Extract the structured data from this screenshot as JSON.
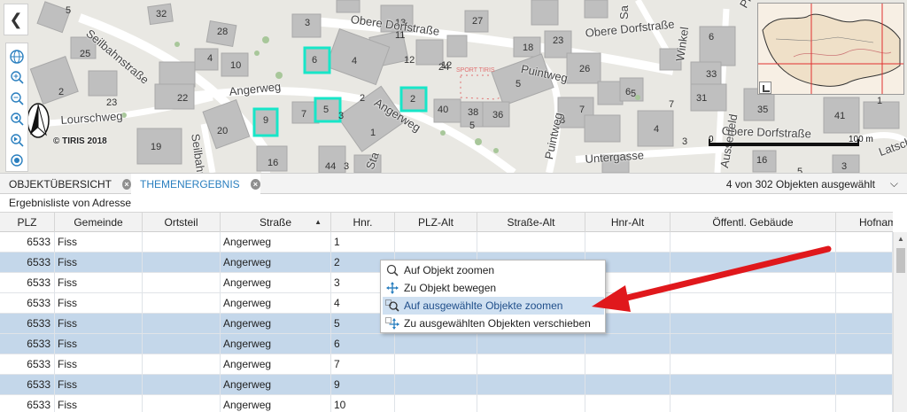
{
  "map": {
    "copyright": "© TIRIS 2018",
    "scale_left": "0",
    "scale_right": "100 m",
    "streets": [
      "Obere Dorfstraße",
      "Seilbahnstraße",
      "Angerweg",
      "Lourschweg",
      "Angerweg",
      "Puintweg",
      "Puintweg",
      "Obere Dorfstraße",
      "Obere Dorfstraße",
      "Untergasse",
      "Winkel",
      "Seilbahn",
      "Sa",
      "Latsch",
      "Pla",
      "Ausserfeld",
      "Sta"
    ],
    "house_numbers": [
      "32",
      "3",
      "13",
      "27",
      "5",
      "28",
      "11",
      "18",
      "23",
      "4",
      "25",
      "6",
      "4",
      "10",
      "12",
      "24",
      "26",
      "6",
      "33",
      "2",
      "23",
      "22",
      "2",
      "5",
      "6",
      "12",
      "31",
      "9",
      "7",
      "5",
      "3",
      "2",
      "40",
      "38",
      "36",
      "7",
      "35",
      "41",
      "20",
      "1",
      "4",
      "7",
      "5",
      "3",
      "1",
      "19",
      "16",
      "44",
      "3",
      "5",
      "8",
      "16",
      "5",
      "3"
    ],
    "poi_label": "SPORT TIRIS"
  },
  "toolbar": {
    "collapse_icon": "chevron-left-icon",
    "tools": [
      "globe-icon",
      "zoom-in-icon",
      "zoom-out-icon",
      "zoom-previous-icon",
      "zoom-next-icon",
      "locate-icon"
    ]
  },
  "tabs": [
    {
      "label": "OBJEKTÜBERSICHT",
      "active": false
    },
    {
      "label": "THEMENERGEBNIS",
      "active": true
    }
  ],
  "tab_status": "4 von 302 Objekten ausgewählt",
  "result_title": "Ergebnisliste von Adresse",
  "columns": [
    "PLZ",
    "Gemeinde",
    "Ortsteil",
    "Straße",
    "Hnr.",
    "PLZ-Alt",
    "Straße-Alt",
    "Hnr-Alt",
    "Öffentl. Gebäude",
    "Hofname"
  ],
  "sort_column": "Straße",
  "rows": [
    {
      "plz": "6533",
      "gemeinde": "Fiss",
      "ortsteil": "",
      "strasse": "Angerweg",
      "hnr": "1",
      "selected": false
    },
    {
      "plz": "6533",
      "gemeinde": "Fiss",
      "ortsteil": "",
      "strasse": "Angerweg",
      "hnr": "2",
      "selected": true
    },
    {
      "plz": "6533",
      "gemeinde": "Fiss",
      "ortsteil": "",
      "strasse": "Angerweg",
      "hnr": "3",
      "selected": false
    },
    {
      "plz": "6533",
      "gemeinde": "Fiss",
      "ortsteil": "",
      "strasse": "Angerweg",
      "hnr": "4",
      "selected": false
    },
    {
      "plz": "6533",
      "gemeinde": "Fiss",
      "ortsteil": "",
      "strasse": "Angerweg",
      "hnr": "5",
      "selected": true
    },
    {
      "plz": "6533",
      "gemeinde": "Fiss",
      "ortsteil": "",
      "strasse": "Angerweg",
      "hnr": "6",
      "selected": true
    },
    {
      "plz": "6533",
      "gemeinde": "Fiss",
      "ortsteil": "",
      "strasse": "Angerweg",
      "hnr": "7",
      "selected": false
    },
    {
      "plz": "6533",
      "gemeinde": "Fiss",
      "ortsteil": "",
      "strasse": "Angerweg",
      "hnr": "9",
      "selected": true
    },
    {
      "plz": "6533",
      "gemeinde": "Fiss",
      "ortsteil": "",
      "strasse": "Angerweg",
      "hnr": "10",
      "selected": false
    }
  ],
  "context_menu": [
    {
      "label": "Auf Objekt zoomen",
      "icon": "magnifier-icon",
      "highlighted": false
    },
    {
      "label": "Zu Objekt bewegen",
      "icon": "move-icon",
      "highlighted": false
    },
    {
      "label": "Auf ausgewählte Objekte zoomen",
      "icon": "zoom-selection-icon",
      "highlighted": true
    },
    {
      "label": "Zu ausgewählten Objekten verschieben",
      "icon": "move-selection-icon",
      "highlighted": false
    }
  ],
  "colors": {
    "selection_row": "#c4d7ea",
    "highlight_menu": "#cfe0f1",
    "accent_tab": "#2a7fbf",
    "annotation_arrow": "#e0181c",
    "map_selection": "#17e6c8"
  }
}
